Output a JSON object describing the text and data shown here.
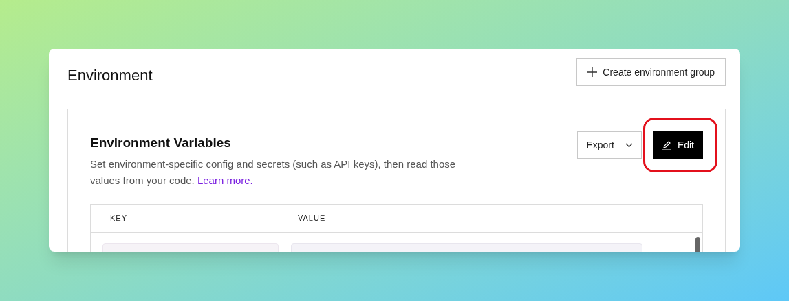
{
  "page": {
    "title": "Environment",
    "action": {
      "label": "Create environment group"
    }
  },
  "section": {
    "title": "Environment Variables",
    "description": "Set environment-specific config and secrets (such as API keys), then read those values from your code.",
    "link": "Learn more.",
    "buttons": [
      {
        "kind": "dropdown",
        "label": "Export",
        "highlighted": false
      },
      {
        "kind": "primary",
        "label": "Edit",
        "highlighted": true
      }
    ]
  },
  "table": {
    "columns": [
      "KEY",
      "VALUE"
    ]
  }
}
